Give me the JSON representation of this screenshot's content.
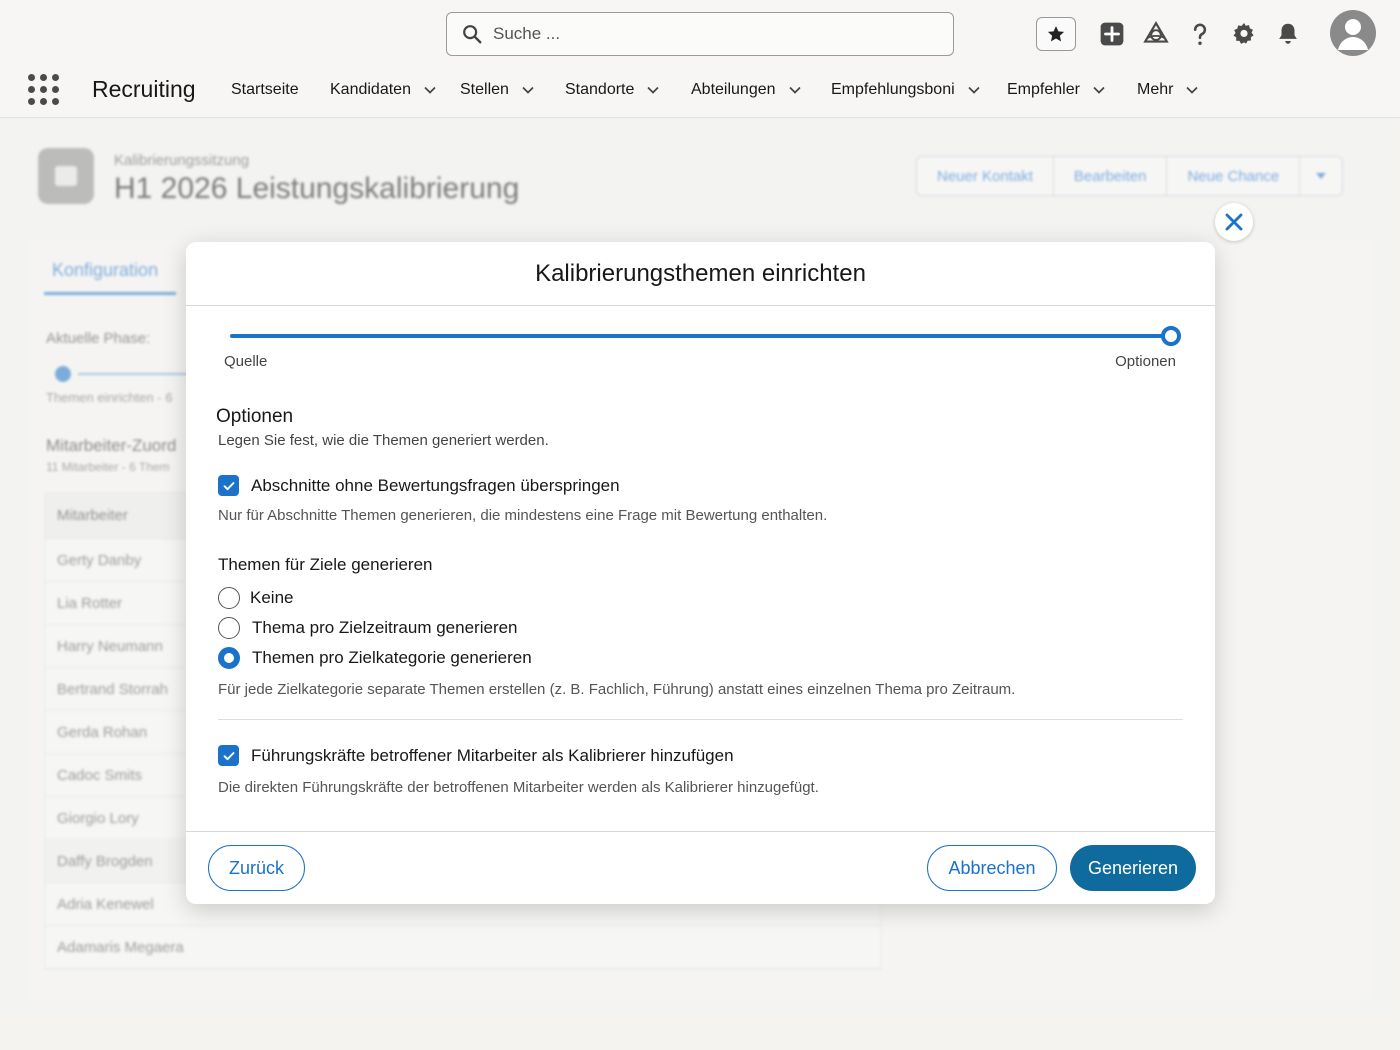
{
  "header": {
    "search_placeholder": "Suche ...",
    "app_name": "Recruiting",
    "nav": [
      {
        "label": "Startseite",
        "has_menu": false
      },
      {
        "label": "Kandidaten",
        "has_menu": true
      },
      {
        "label": "Stellen",
        "has_menu": true
      },
      {
        "label": "Standorte",
        "has_menu": true
      },
      {
        "label": "Abteilungen",
        "has_menu": true
      },
      {
        "label": "Empfehlungsboni",
        "has_menu": true
      },
      {
        "label": "Empfehler",
        "has_menu": true
      },
      {
        "label": "Mehr",
        "has_menu": true
      }
    ],
    "icons": [
      "favorites-star-icon",
      "global-actions-add-icon",
      "trailhead-icon",
      "help-icon",
      "setup-gear-icon",
      "notifications-bell-icon",
      "user-avatar"
    ]
  },
  "record": {
    "type": "Kalibrierungssitzung",
    "title": "H1 2026 Leistungskalibrierung",
    "actions": [
      "Neuer Kontakt",
      "Bearbeiten",
      "Neue Chance"
    ]
  },
  "background": {
    "tab": "Konfiguration",
    "phase_label": "Aktuelle Phase:",
    "phase_step": "Themen einrichten - 6",
    "section_title": "Mitarbeiter-Zuord",
    "section_sub": "11 Mitarbeiter - 6 Them",
    "table_header": "Mitarbeiter",
    "employees": [
      "Gerty Danby",
      "Lia Rotter",
      "Harry Neumann",
      "Bertrand Storrah",
      "Gerda Rohan",
      "Cadoc Smits",
      "Giorgio Lory",
      "Daffy Brogden",
      "Adria Kenewel",
      "Adamaris Megaera"
    ]
  },
  "modal": {
    "title": "Kalibrierungsthemen einrichten",
    "steps": [
      "Quelle",
      "Optionen"
    ],
    "progress_fraction": 1.0,
    "section_title": "Optionen",
    "section_sub": "Legen Sie fest, wie die Themen generiert werden.",
    "skip_option": {
      "label": "Abschnitte ohne Bewertungsfragen überspringen",
      "checked": true,
      "help": "Nur für Abschnitte Themen generieren, die mindestens eine Frage mit Bewertung enthalten."
    },
    "goals_group": {
      "title": "Themen für Ziele generieren",
      "options": [
        {
          "label": "Keine",
          "checked": false
        },
        {
          "label": "Thema pro Zielzeitraum generieren",
          "checked": false
        },
        {
          "label": "Themen pro Zielkategorie generieren",
          "checked": true
        }
      ],
      "help": "Für jede Zielkategorie separate Themen erstellen (z. B. Fachlich, Führung) anstatt eines einzelnen Thema pro Zeitraum."
    },
    "managers_option": {
      "label": "Führungskräfte betroffener Mitarbeiter als Kalibrierer hinzufügen",
      "checked": true,
      "help": "Die direkten Führungskräfte der betroffenen Mitarbeiter werden als Kalibrierer hinzugefügt."
    },
    "buttons": {
      "back": "Zurück",
      "cancel": "Abbrechen",
      "generate": "Generieren"
    }
  },
  "colors": {
    "brand": "#1b72c9",
    "primary_button": "#0f6a9e"
  }
}
